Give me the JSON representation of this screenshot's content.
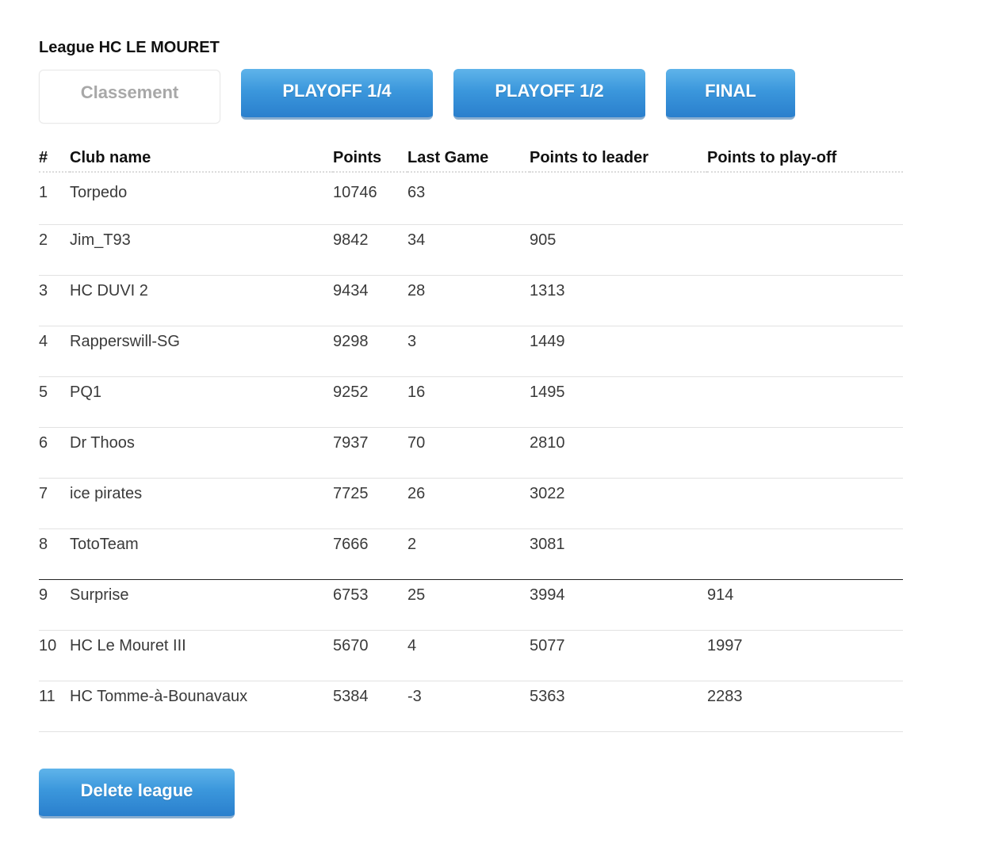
{
  "league": {
    "title": "League HC LE MOURET"
  },
  "tabs": [
    {
      "label": "Classement",
      "state": "selected"
    },
    {
      "label": "PLAYOFF 1/4",
      "state": "button"
    },
    {
      "label": "PLAYOFF 1/2",
      "state": "button"
    },
    {
      "label": "FINAL",
      "state": "button"
    }
  ],
  "table": {
    "headers": {
      "rank": "#",
      "club": "Club name",
      "points": "Points",
      "last_game": "Last Game",
      "to_leader": "Points to leader",
      "to_playoff": "Points to play-off"
    },
    "rows": [
      {
        "rank": "1",
        "club": "Torpedo",
        "points": "10746",
        "last_game": "63",
        "to_leader": "",
        "to_playoff": ""
      },
      {
        "rank": "2",
        "club": "Jim_T93",
        "points": "9842",
        "last_game": "34",
        "to_leader": "905",
        "to_playoff": ""
      },
      {
        "rank": "3",
        "club": "HC DUVI 2",
        "points": "9434",
        "last_game": "28",
        "to_leader": "1313",
        "to_playoff": ""
      },
      {
        "rank": "4",
        "club": "Rapperswill-SG",
        "points": "9298",
        "last_game": "3",
        "to_leader": "1449",
        "to_playoff": ""
      },
      {
        "rank": "5",
        "club": "PQ1",
        "points": "9252",
        "last_game": "16",
        "to_leader": "1495",
        "to_playoff": ""
      },
      {
        "rank": "6",
        "club": "Dr Thoos",
        "points": "7937",
        "last_game": "70",
        "to_leader": "2810",
        "to_playoff": ""
      },
      {
        "rank": "7",
        "club": "ice pirates",
        "points": "7725",
        "last_game": "26",
        "to_leader": "3022",
        "to_playoff": ""
      },
      {
        "rank": "8",
        "club": "TotoTeam",
        "points": "7666",
        "last_game": "2",
        "to_leader": "3081",
        "to_playoff": ""
      },
      {
        "rank": "9",
        "club": "Surprise",
        "points": "6753",
        "last_game": "25",
        "to_leader": "3994",
        "to_playoff": "914"
      },
      {
        "rank": "10",
        "club": "HC Le Mouret III",
        "points": "5670",
        "last_game": "4",
        "to_leader": "5077",
        "to_playoff": "1997"
      },
      {
        "rank": "11",
        "club": "HC Tomme-à-Bounavaux",
        "points": "5384",
        "last_game": "-3",
        "to_leader": "5363",
        "to_playoff": "2283"
      }
    ]
  },
  "actions": {
    "delete_label": "Delete league"
  },
  "colors": {
    "button_blue": "#3b97dc",
    "button_text": "#ffffff",
    "inactive_tab_text": "#a8a8a8",
    "cutoff_line": "#222222"
  }
}
